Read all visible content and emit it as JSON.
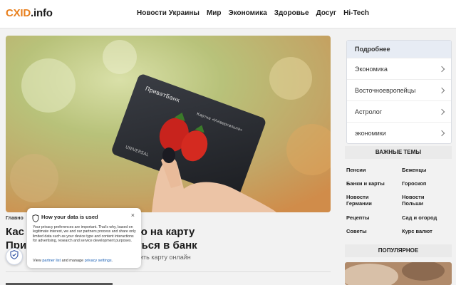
{
  "header": {
    "logo_brand": "CXID",
    "logo_tld": ".info",
    "nav": [
      "Новости Украины",
      "Мир",
      "Экономика",
      "Здоровье",
      "Досуг",
      "Hi-Tech"
    ]
  },
  "article": {
    "breadcrumb": "Главно",
    "headline_line1": "Кас                   чает пенсию на карту",
    "headline_line2": "При                   но обратиться в банк",
    "lead": "м                         арты или можно перевыпустить карту онлайн",
    "card_bank_text": "ПриватБанк",
    "card_line_text": "Картка «Універсальна»",
    "card_universal_text": "UNIVERSAL"
  },
  "sidebar": {
    "more_title": "Подробнее",
    "more_items": [
      "Экономика",
      "Восточноевропейцы",
      "Астролог",
      "экономики"
    ],
    "important_title": "ВАЖНЫЕ ТЕМЫ",
    "topics": [
      {
        "label": "Пенсии"
      },
      {
        "label": "Беженцы"
      },
      {
        "label": "Банки и карты"
      },
      {
        "label": "Гороскоп"
      },
      {
        "label": "Новости Германии"
      },
      {
        "label": "Новости Польши"
      },
      {
        "label": "Рецепты"
      },
      {
        "label": "Сад и огород"
      },
      {
        "label": "Советы"
      },
      {
        "label": "Курс валют"
      }
    ],
    "popular_title": "ПОПУЛЯРНОЕ"
  },
  "privacy": {
    "title": "How your data is used",
    "close": "×",
    "body": "Your privacy preferences are important. That's why, based on legitimate interest, we and our partners process and share only limited data such as your device type and content interactions for advertising, research and service development purposes.",
    "view_text": "View",
    "partner_link": "partner list",
    "and_manage": "and manage",
    "settings_link": "privacy settings",
    "period": "."
  },
  "colors": {
    "brand": "#e8801e",
    "link": "#1a5fb4",
    "more_header_bg": "#e7ecf4"
  },
  "icons": [
    "shield-icon",
    "close-icon",
    "chevron-right-icon"
  ]
}
